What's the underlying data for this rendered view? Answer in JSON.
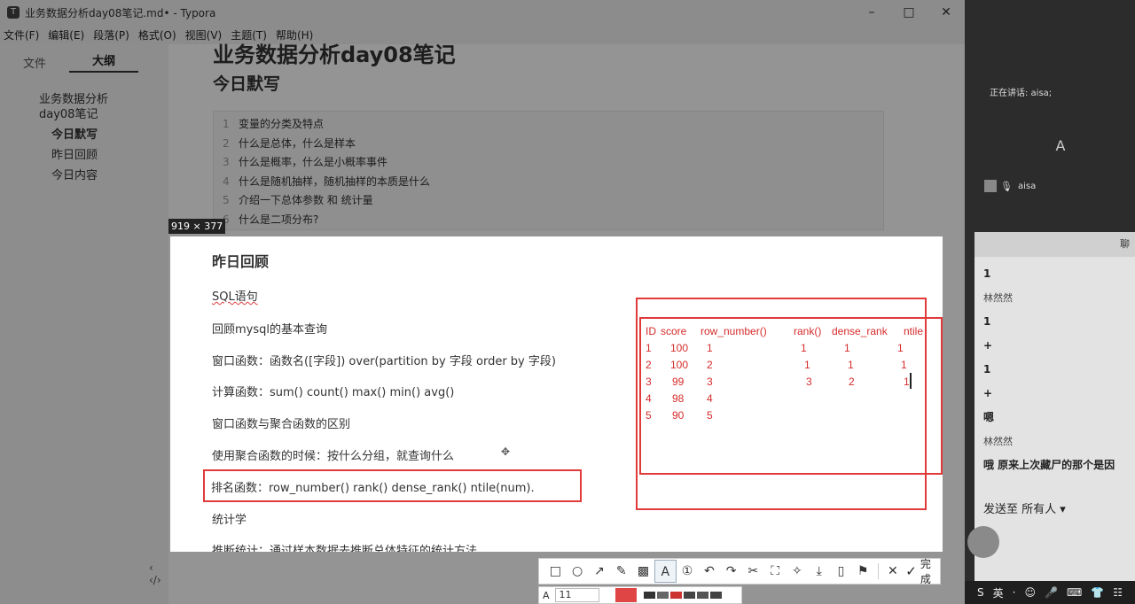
{
  "window": {
    "title": "业务数据分析day08笔记.md• - Typora",
    "controls": [
      "–",
      "□",
      "✕"
    ]
  },
  "menu": [
    "文件(F)",
    "编辑(E)",
    "段落(P)",
    "格式(O)",
    "视图(V)",
    "主题(T)",
    "帮助(H)"
  ],
  "sidebar": {
    "tabs": [
      "文件",
      "大纲"
    ],
    "outline": [
      {
        "label": "业务数据分析day08笔记",
        "level": 1
      },
      {
        "label": "今日默写",
        "level": 2,
        "current": true
      },
      {
        "label": "昨日回顾",
        "level": 2
      },
      {
        "label": "今日内容",
        "level": 2
      }
    ],
    "footer": "‹  ‹/›"
  },
  "doc": {
    "h1": "业务数据分析day08笔记",
    "h2": "今日默写",
    "code_lines": [
      {
        "num": "1",
        "text": "变量的分类及特点"
      },
      {
        "num": "2",
        "text": "什么是总体，什么是样本"
      },
      {
        "num": "3",
        "text": "什么是概率，什么是小概率事件"
      },
      {
        "num": "4",
        "text": "什么是随机抽样，随机抽样的本质是什么"
      },
      {
        "num": "5",
        "text": "介绍一下总体参数 和 统计量"
      },
      {
        "num": "6",
        "text": "什么是二项分布?"
      }
    ]
  },
  "capture": {
    "size_label": "919 × 377",
    "heading": "昨日回顾",
    "lines": [
      "SQL语句",
      "回顾mysql的基本查询",
      "窗口函数：函数名([字段]) over(partition by 字段 order by 字段)",
      "计算函数：sum() count()  max() min() avg()",
      "窗口函数与聚合函数的区别",
      "使用聚合函数的时候：按什么分组，就查询什么"
    ],
    "rank_line": "排名函数：row_number()  rank() dense_rank() ntile(num).",
    "after_lines": [
      "统计学",
      "推断统计：通过样本数据去推断总体特征的统计方法"
    ],
    "table": {
      "headers": [
        "ID",
        "score",
        "row_number()",
        "rank()",
        "dense_rank",
        "ntile"
      ],
      "rows": [
        {
          "id": "1",
          "score": "100",
          "row_number": "1",
          "rank": "1",
          "dense_rank": "1",
          "ntile": "1"
        },
        {
          "id": "2",
          "score": "100",
          "row_number": "2",
          "rank": "1",
          "dense_rank": "1",
          "ntile": "1"
        },
        {
          "id": "3",
          "score": "99",
          "row_number": "3",
          "rank": "3",
          "dense_rank": "2",
          "ntile": "1"
        },
        {
          "id": "4",
          "score": "98",
          "row_number": "4",
          "rank": "",
          "dense_rank": "",
          "ntile": ""
        },
        {
          "id": "5",
          "score": "90",
          "row_number": "5",
          "rank": "",
          "dense_rank": "",
          "ntile": ""
        }
      ],
      "color": "#d62b2b"
    }
  },
  "toolbar": {
    "tools": [
      "rectangle-icon",
      "ellipse-icon",
      "arrow-icon",
      "pen-icon",
      "mosaic-icon",
      "text-icon",
      "number-icon",
      "undo-icon",
      "redo-icon",
      "pin-icon",
      "ocr-icon",
      "translate-icon",
      "download-icon",
      "save-icon",
      "bookmark-icon",
      "close-icon"
    ],
    "done_label": "完成",
    "font_size": "11",
    "current_color": "#e04545"
  },
  "chat": {
    "speaking_label": "正在讲话: aisa;",
    "big_letter": "A",
    "user": "aisa",
    "header": "聊",
    "messages": [
      {
        "text": "1",
        "style": "bold"
      },
      {
        "text": "林然然",
        "style": "name"
      },
      {
        "text": "1",
        "style": "bold"
      },
      {
        "text": "+",
        "style": "bold"
      },
      {
        "text": "1",
        "style": "bold"
      },
      {
        "text": "+",
        "style": "bold"
      },
      {
        "text": "嗯",
        "style": "bold"
      },
      {
        "text": "林然然",
        "style": "name"
      },
      {
        "text": "哦  原来上次藏尸的那个是因",
        "style": "bold"
      }
    ],
    "send_to": "发送至 所有人 ▾",
    "taskbar": [
      "S",
      "英",
      "·",
      "☺",
      "🎤",
      "⌨",
      "👕",
      "☷"
    ]
  }
}
